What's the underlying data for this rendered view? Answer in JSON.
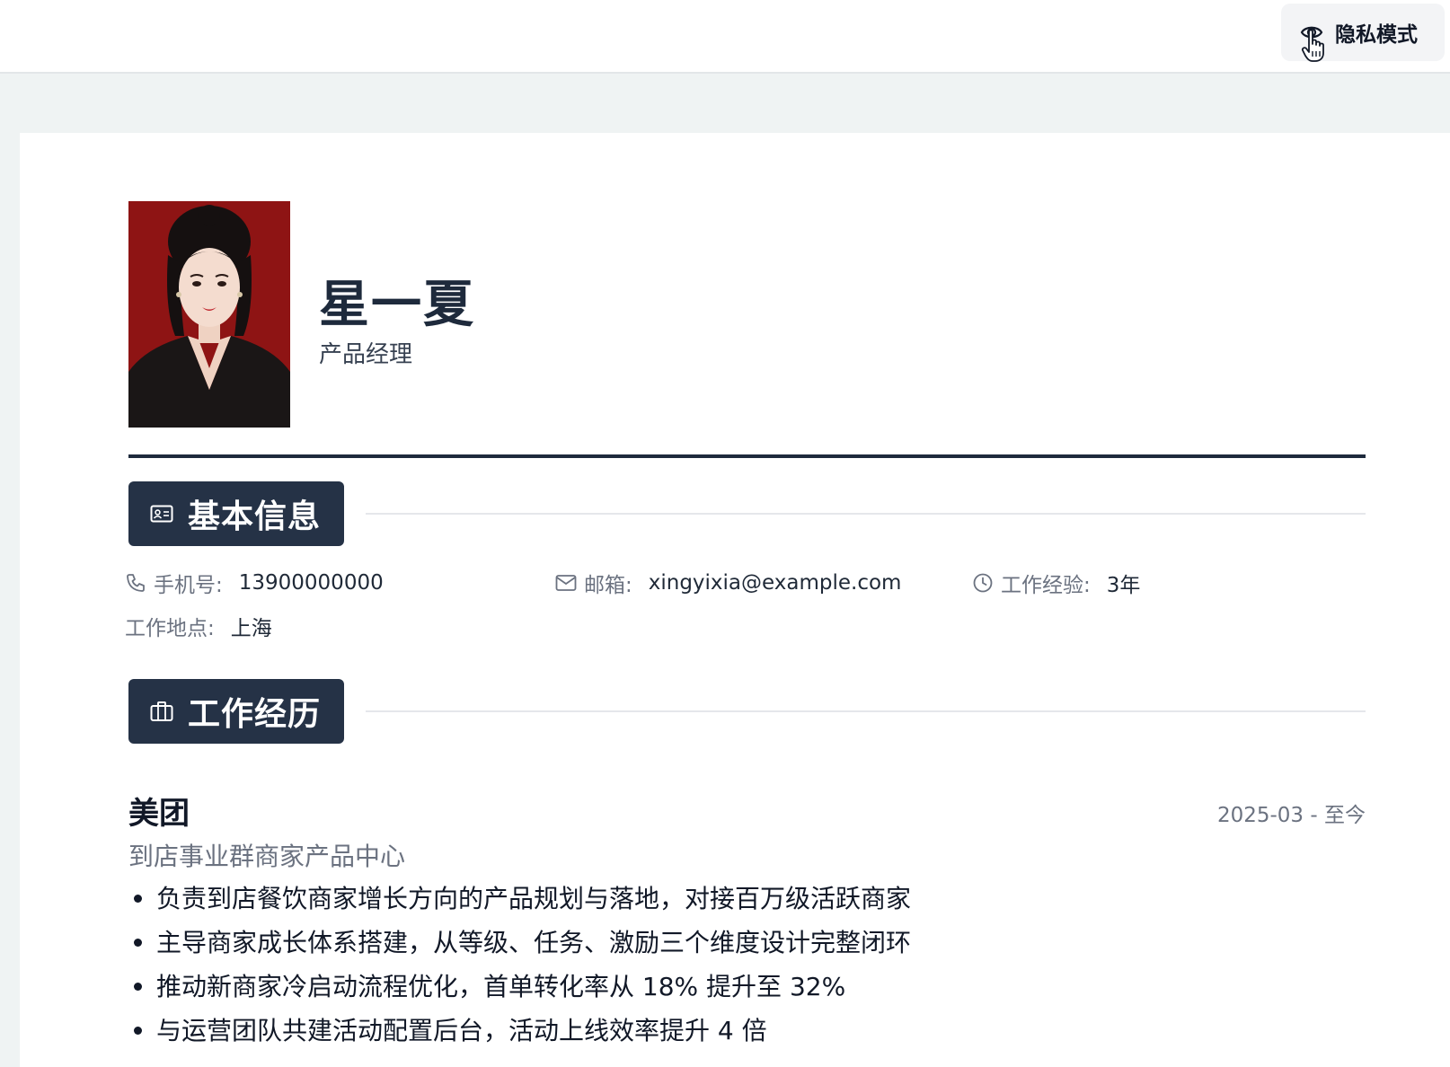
{
  "toolbar": {
    "privacy_label": "隐私模式"
  },
  "profile": {
    "name": "星一夏",
    "role": "产品经理"
  },
  "sections": {
    "basic": "基本信息",
    "work": "工作经历"
  },
  "basic_info": {
    "phone_label": "手机号:",
    "phone": "13900000000",
    "email_label": "邮箱:",
    "email": "xingyixia@example.com",
    "experience_label": "工作经验:",
    "experience": "3年",
    "location_label": "工作地点:",
    "location": "上海"
  },
  "work": {
    "company": "美团",
    "department": "到店事业群商家产品中心",
    "period": "2025-03 - 至今",
    "bullets": [
      "负责到店餐饮商家增长方向的产品规划与落地，对接百万级活跃商家",
      "主导商家成长体系搭建，从等级、任务、激励三个维度设计完整闭环",
      "推动新商家冷启动流程优化，首单转化率从 18% 提升至 32%",
      "与运营团队共建活动配置后台，活动上线效率提升 4 倍"
    ]
  },
  "colors": {
    "header_dark": "#253246",
    "name_color": "#1e2a3c",
    "photo_bg": "#8e1414"
  }
}
